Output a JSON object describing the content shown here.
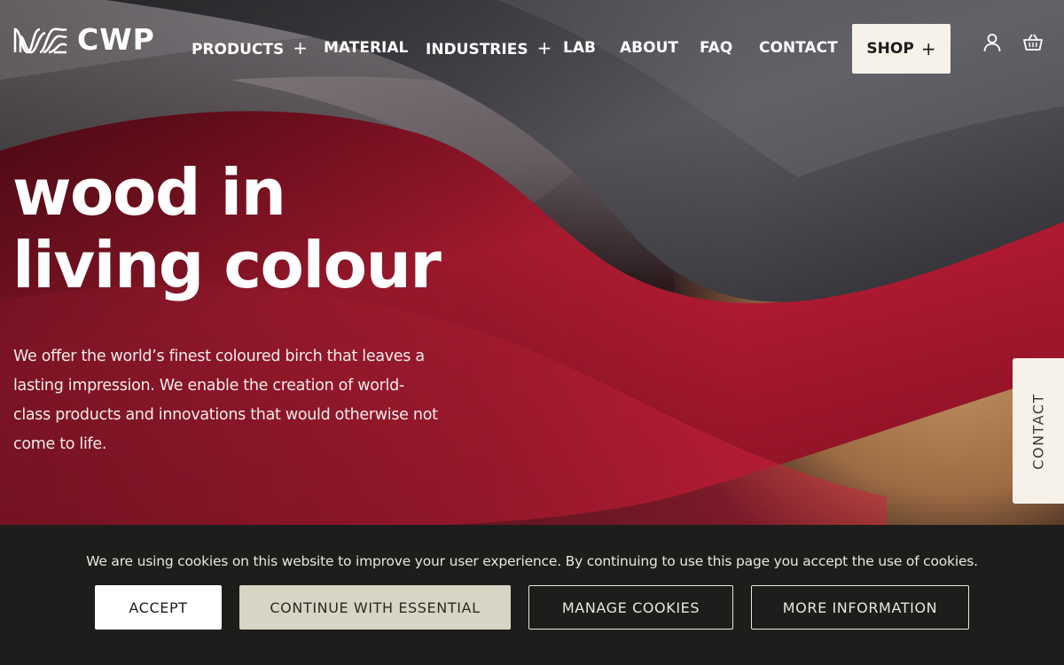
{
  "brand": {
    "name": "CWP",
    "logo_icon": "wave-lines-logo-icon"
  },
  "nav": {
    "items": [
      {
        "label": "PRODUCTS",
        "has_submenu": true,
        "submenu_glyph": "+"
      },
      {
        "label": "MATERIAL",
        "has_submenu": false
      },
      {
        "label": "INDUSTRIES",
        "has_submenu": true,
        "submenu_glyph": "+"
      },
      {
        "label": "LAB",
        "has_submenu": false
      },
      {
        "label": "ABOUT",
        "has_submenu": false
      },
      {
        "label": "FAQ",
        "has_submenu": false
      },
      {
        "label": "CONTACT",
        "has_submenu": false
      }
    ],
    "shop": {
      "label": "SHOP",
      "glyph": "+"
    },
    "icons": {
      "account": "user-icon",
      "basket": "basket-icon"
    }
  },
  "hero": {
    "headline_line1": "wood in",
    "headline_line2": "living colour",
    "intro": "We offer the world’s finest coloured birch that leaves a lasting impression. We enable the creation of world-class products and innovations that would otherwise not come to life."
  },
  "side_tab": {
    "label": "CONTACT"
  },
  "cookie": {
    "message": "We are using cookies on this website to improve your user experience. By continuing to use this page you accept the use of cookies.",
    "accept_label": "ACCEPT",
    "essential_label": "CONTINUE WITH ESSENTIAL",
    "manage_label": "MANAGE COOKIES",
    "more_label": "MORE INFORMATION"
  },
  "colors": {
    "cream": "#f6f2ea",
    "cookie_bg": "#1d1d1b",
    "essential_btn": "#d8d5c4",
    "veneer_red": "#b3192f",
    "veneer_grey": "#4a4a4e"
  }
}
